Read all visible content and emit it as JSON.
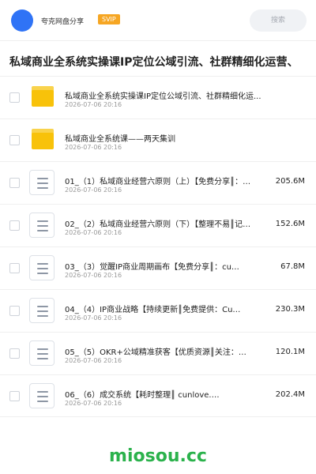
{
  "header": {
    "username": "夸克网盘分享",
    "badge": "SVIP",
    "search_placeholder": "搜索"
  },
  "page_title": "私域商业全系统实操课IP定位公域引流、社群精细化运营、",
  "files": [
    {
      "type": "folder",
      "name": "私域商业全系统实操课IP定位公域引流、社群精细化运...",
      "date": "2026-07-06 20:16",
      "size": ""
    },
    {
      "type": "folder",
      "name": "私域商业全系统课——两天集训",
      "date": "2026-07-06 20:16",
      "size": ""
    },
    {
      "type": "file",
      "name": "01_（1）私域商业经营六原则（上）【免费分享║：…",
      "date": "2026-07-06 20:16",
      "size": "205.6M"
    },
    {
      "type": "file",
      "name": "02_（2）私域商业经营六原则（下）【整理不易║记…",
      "date": "2026-07-06 20:16",
      "size": "152.6M"
    },
    {
      "type": "file",
      "name": "03_（3）觉醒IP商业周期画布【免费分享║：cu…",
      "date": "2026-07-06 20:16",
      "size": "67.8M"
    },
    {
      "type": "file",
      "name": "04_（4）IP商业战略【持续更新║免费提供：Cu…",
      "date": "2026-07-06 20:16",
      "size": "230.3M"
    },
    {
      "type": "file",
      "name": "05_（5）OKR+公域精准获客【优质资源║关注：…",
      "date": "2026-07-06 20:16",
      "size": "120.1M"
    },
    {
      "type": "file",
      "name": "06_（6）成交系统【耗时整理║ cunlove.…",
      "date": "2026-07-06 20:16",
      "size": "202.4M"
    }
  ],
  "watermark": "miosou.cc"
}
